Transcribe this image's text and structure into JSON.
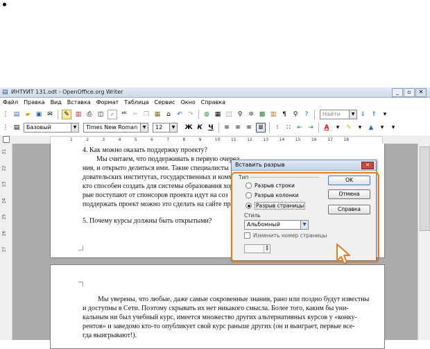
{
  "window": {
    "title": "ИНТУИТ 131.odt - OpenOffice.org Writer",
    "controls": [
      "_",
      "▫",
      "✕"
    ]
  },
  "menu": [
    "Файл",
    "Правка",
    "Вид",
    "Вставка",
    "Формат",
    "Таблица",
    "Сервис",
    "Окно",
    "Справка"
  ],
  "toolbar": {
    "find_placeholder": "Найти"
  },
  "formatting": {
    "style": "Базовый",
    "font": "Times New Roman",
    "size": "12",
    "bold": "Ж",
    "italic": "К",
    "underline": "Ч"
  },
  "ruler": [
    "1",
    "2",
    "3",
    "4",
    "5",
    "6",
    "7",
    "8",
    "9",
    "10",
    "11",
    "12",
    "13",
    "14",
    "15",
    "16",
    "17",
    "18"
  ],
  "vruler": [
    "21",
    "22",
    "23",
    "24",
    "25",
    "26",
    "27"
  ],
  "document": {
    "page1": [
      "4.  Как можно оказать поддержку проекту?",
      "Мы считаем, что поддерживать в первую очеред",
      "ния, и открыто делиться ими. Такие специалисты е",
      "довательских институтах, государственных и комм",
      "кто способен создать для системы образования хор",
      "рые поступают от спонсоров проекта идут на соз",
      "поддержать проект можно это сделать на сайте проек",
      "5.  Почему курсы должны быть открытыми?"
    ],
    "page2": [
      "Мы уверены, что любые, даже самые сокровенные знания, рано или поздно будут известны",
      "и доступны в Сети. Поэтому скрывать их нет никакого смысла. Более того, каким бы уни-",
      "кальным ни был учебный курс, имеется множество других альтернативных курсов у «конку-",
      "рентов» и заведомо кто-то опубликует свой курс раньше других (он и выиграет, первые все-",
      "гда выигрывают!)."
    ]
  },
  "dialog": {
    "title": "Вставить разрыв",
    "close": "✕",
    "type_label": "Тип",
    "options": [
      "Разрыв строки",
      "Разрыв колонки",
      "Разрыв страницы"
    ],
    "selected_option": "Разрыв страницы",
    "style_label": "Стиль",
    "style_value": "Альбомный",
    "change_page_number": "Изменить номер страницы",
    "buttons": {
      "ok": "OK",
      "cancel": "Отмена",
      "help": "Справка"
    }
  },
  "colors": {
    "highlight": "#e87b16",
    "workspace": "#ababab"
  }
}
